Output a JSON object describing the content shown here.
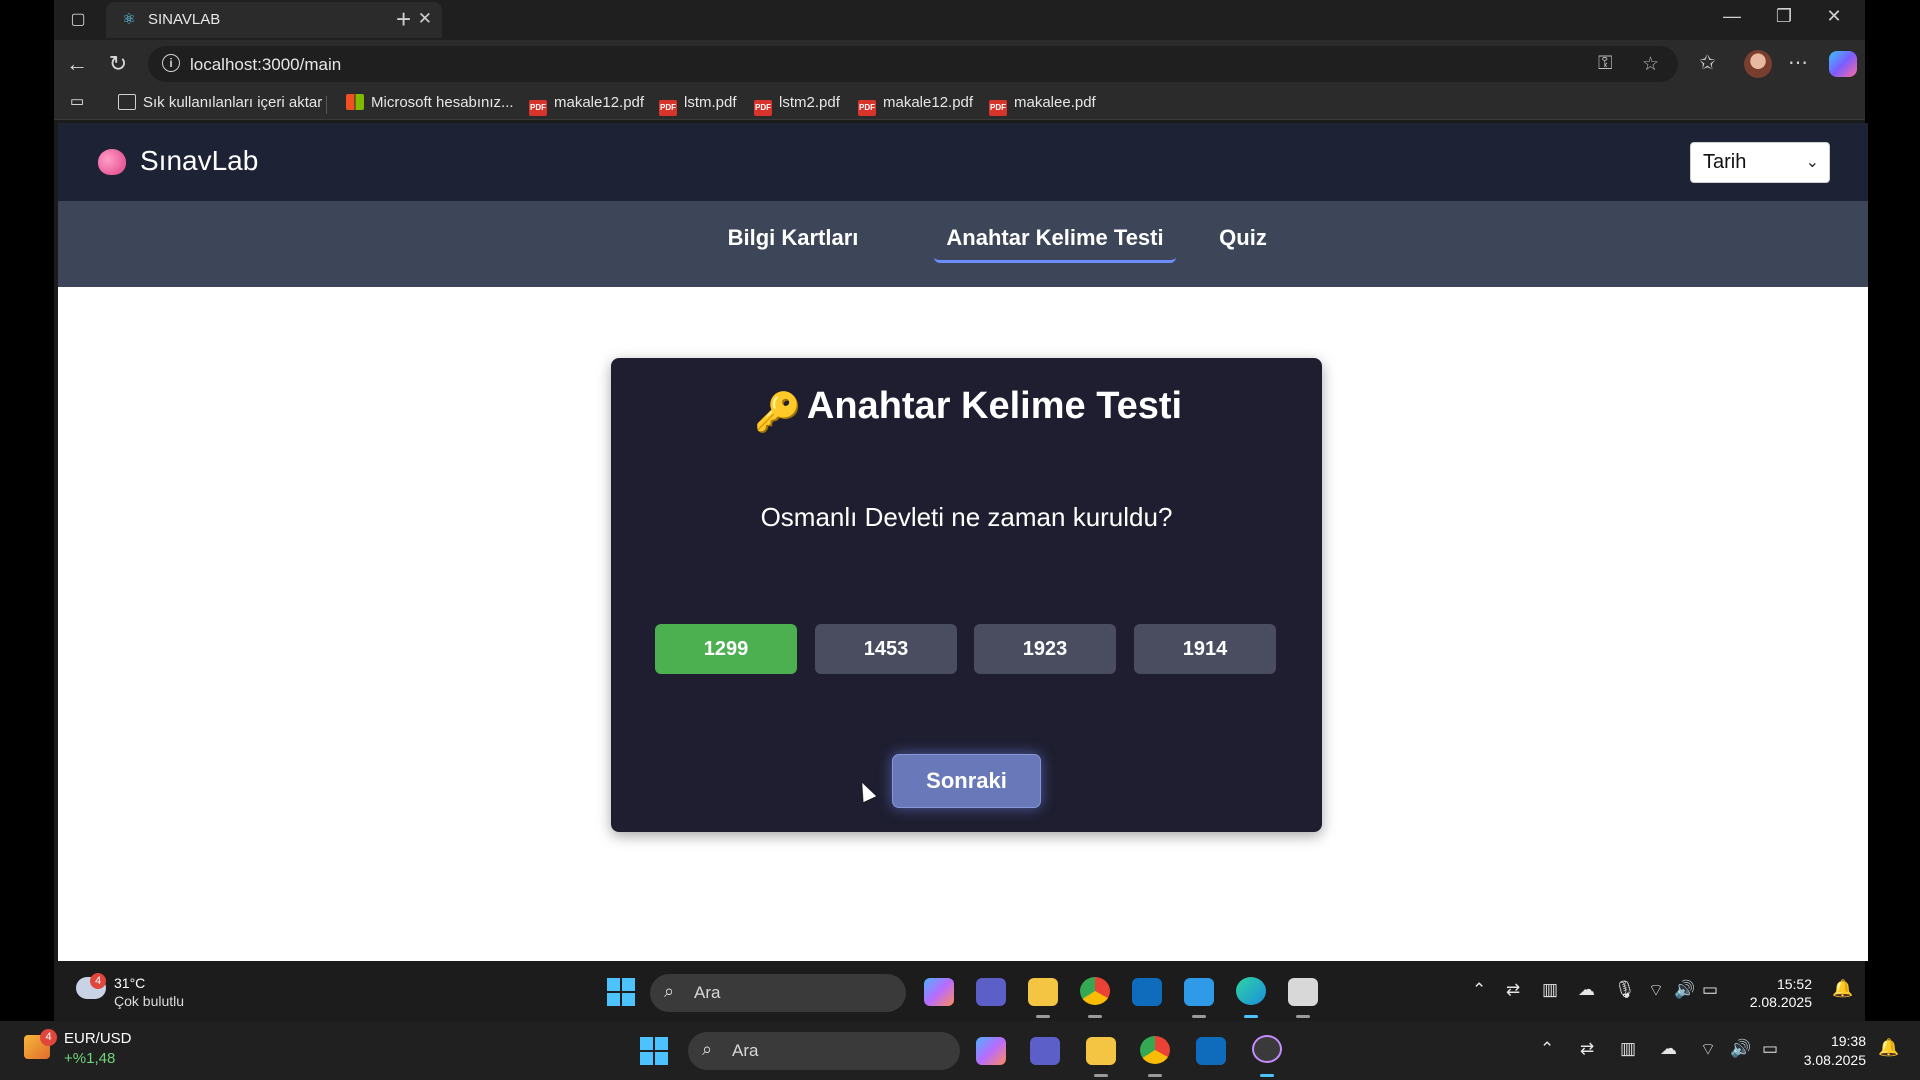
{
  "browser": {
    "tab_title": "SINAVLAB",
    "url": "localhost:3000/main",
    "bookmarks": [
      {
        "label": "Sık kullanılanları içeri aktar",
        "icon": "import-icon"
      },
      {
        "label": "Microsoft hesabınız...",
        "icon": "microsoft-icon"
      },
      {
        "label": "makale12.pdf",
        "icon": "pdf-icon"
      },
      {
        "label": "lstm.pdf",
        "icon": "pdf-icon"
      },
      {
        "label": "lstm2.pdf",
        "icon": "pdf-icon"
      },
      {
        "label": "makale12.pdf",
        "icon": "pdf-icon"
      },
      {
        "label": "makalee.pdf",
        "icon": "pdf-icon"
      }
    ]
  },
  "app": {
    "logo_text": "SınavLab",
    "filter_select": {
      "selected": "Tarih"
    },
    "nav_tabs": [
      {
        "label": "Bilgi Kartları",
        "active": false
      },
      {
        "label": "Anahtar Kelime Testi",
        "active": true
      },
      {
        "label": "Quiz",
        "active": false
      }
    ],
    "card": {
      "icon": "🔑",
      "title": "Anahtar Kelime Testi",
      "question": "Osmanlı Devleti ne zaman kuruldu?",
      "options": [
        {
          "label": "1299",
          "state": "correct"
        },
        {
          "label": "1453",
          "state": "neutral"
        },
        {
          "label": "1923",
          "state": "neutral"
        },
        {
          "label": "1914",
          "state": "neutral"
        }
      ],
      "next_label": "Sonraki"
    },
    "colors": {
      "header_bg": "#1e2235",
      "nav_bg": "#3c4658",
      "card_bg": "#1e1e30",
      "correct": "#4caf50",
      "option_bg": "#4a4c60",
      "next_bg": "#6878b8"
    }
  },
  "inner_taskbar": {
    "weather_badge": "4",
    "weather_temp": "31°C",
    "weather_desc": "Çok bulutlu",
    "search_label": "Ara",
    "time": "15:52",
    "date": "2.08.2025"
  },
  "outer_taskbar": {
    "ticker_badge": "4",
    "ticker_name": "EUR/USD",
    "ticker_change": "+%1,48",
    "search_label": "Ara",
    "time": "19:38",
    "date": "3.08.2025"
  }
}
